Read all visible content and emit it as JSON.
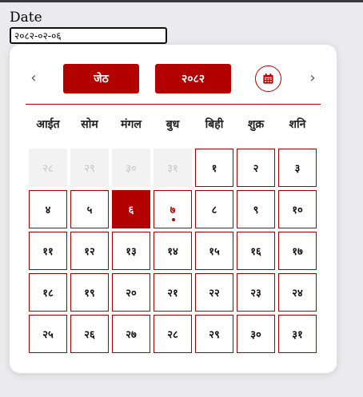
{
  "field": {
    "label": "Date",
    "value": "२०८२-०२-०६"
  },
  "calendar": {
    "month_label": "जेठ",
    "year_label": "२०८२",
    "weekdays": [
      "आईत",
      "सोम",
      "मंगल",
      "बुध",
      "बिही",
      "शुक्र",
      "शनि"
    ],
    "days": [
      {
        "label": "२८",
        "state": "outside"
      },
      {
        "label": "२९",
        "state": "outside"
      },
      {
        "label": "३०",
        "state": "outside"
      },
      {
        "label": "३१",
        "state": "outside"
      },
      {
        "label": "१",
        "state": "normal"
      },
      {
        "label": "२",
        "state": "normal"
      },
      {
        "label": "३",
        "state": "normal"
      },
      {
        "label": "४",
        "state": "normal"
      },
      {
        "label": "५",
        "state": "normal"
      },
      {
        "label": "६",
        "state": "selected"
      },
      {
        "label": "७",
        "state": "today"
      },
      {
        "label": "८",
        "state": "normal"
      },
      {
        "label": "९",
        "state": "normal"
      },
      {
        "label": "१०",
        "state": "normal"
      },
      {
        "label": "११",
        "state": "normal"
      },
      {
        "label": "१२",
        "state": "normal"
      },
      {
        "label": "१३",
        "state": "normal"
      },
      {
        "label": "१४",
        "state": "normal"
      },
      {
        "label": "१५",
        "state": "normal"
      },
      {
        "label": "१६",
        "state": "normal"
      },
      {
        "label": "१७",
        "state": "normal"
      },
      {
        "label": "१८",
        "state": "normal"
      },
      {
        "label": "१९",
        "state": "normal"
      },
      {
        "label": "२०",
        "state": "normal"
      },
      {
        "label": "२१",
        "state": "normal"
      },
      {
        "label": "२२",
        "state": "normal"
      },
      {
        "label": "२३",
        "state": "normal"
      },
      {
        "label": "२४",
        "state": "normal"
      },
      {
        "label": "२५",
        "state": "normal"
      },
      {
        "label": "२६",
        "state": "normal"
      },
      {
        "label": "२७",
        "state": "normal"
      },
      {
        "label": "२८",
        "state": "normal"
      },
      {
        "label": "२९",
        "state": "normal"
      },
      {
        "label": "३०",
        "state": "normal"
      },
      {
        "label": "३१",
        "state": "normal"
      }
    ]
  },
  "icons": {
    "prev": "chevron-left-icon",
    "next": "chevron-right-icon",
    "today": "calendar-icon"
  },
  "colors": {
    "accent": "#b30000",
    "outside_bg": "#f2f2f2",
    "outside_text": "#c4c4c4"
  }
}
